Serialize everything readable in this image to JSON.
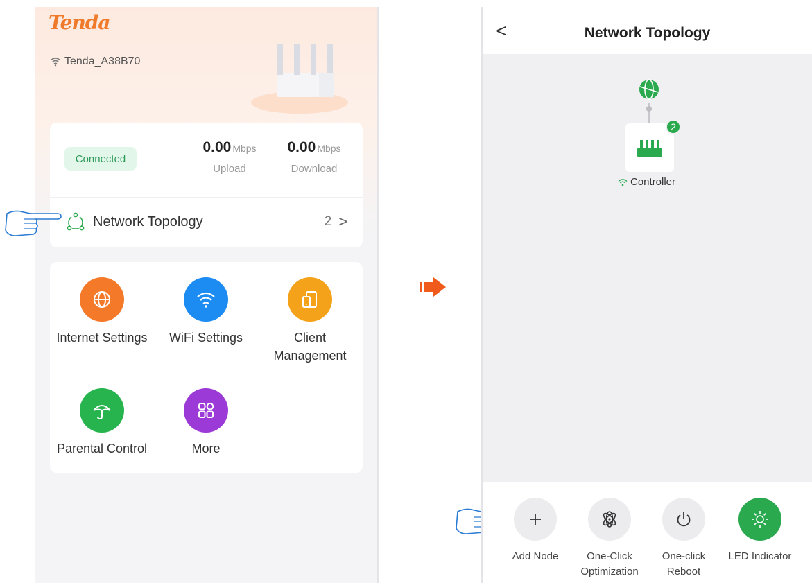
{
  "home": {
    "brand": "Tenda",
    "ssid": "Tenda_A38B70",
    "status_badge": "Connected",
    "upload": {
      "value": "0.00",
      "unit": "Mbps",
      "label": "Upload"
    },
    "download": {
      "value": "0.00",
      "unit": "Mbps",
      "label": "Download"
    },
    "topology": {
      "label": "Network Topology",
      "count": "2",
      "chevron": ">"
    },
    "apps": [
      {
        "label": "Internet Settings",
        "icon": "globe-icon",
        "color": "#f47a2a"
      },
      {
        "label": "WiFi Settings",
        "icon": "wifi-icon",
        "color": "#1d8cf2"
      },
      {
        "label": "Client Management",
        "icon": "devices-icon",
        "color": "#f5a21b"
      },
      {
        "label": "Parental Control",
        "icon": "umbrella-icon",
        "color": "#27b34e"
      },
      {
        "label": "More",
        "icon": "grid-icon",
        "color": "#9b3ad6"
      }
    ]
  },
  "topology_page": {
    "back": "<",
    "title": "Network Topology",
    "node_count_badge": "2",
    "node_label": "Controller",
    "actions": [
      {
        "label_line1": "Add Node",
        "label_line2": "",
        "icon": "plus-icon"
      },
      {
        "label_line1": "One-Click",
        "label_line2": "Optimization",
        "icon": "atom-icon"
      },
      {
        "label_line1": "One-click",
        "label_line2": "Reboot",
        "icon": "power-icon"
      },
      {
        "label_line1": "LED Indicator",
        "label_line2": "",
        "icon": "sun-icon",
        "active_color": "#2aa94f"
      }
    ]
  },
  "colors": {
    "brand_orange": "#f07a2c",
    "accent_green": "#2aa94f",
    "arrow": "#f05a1a"
  }
}
